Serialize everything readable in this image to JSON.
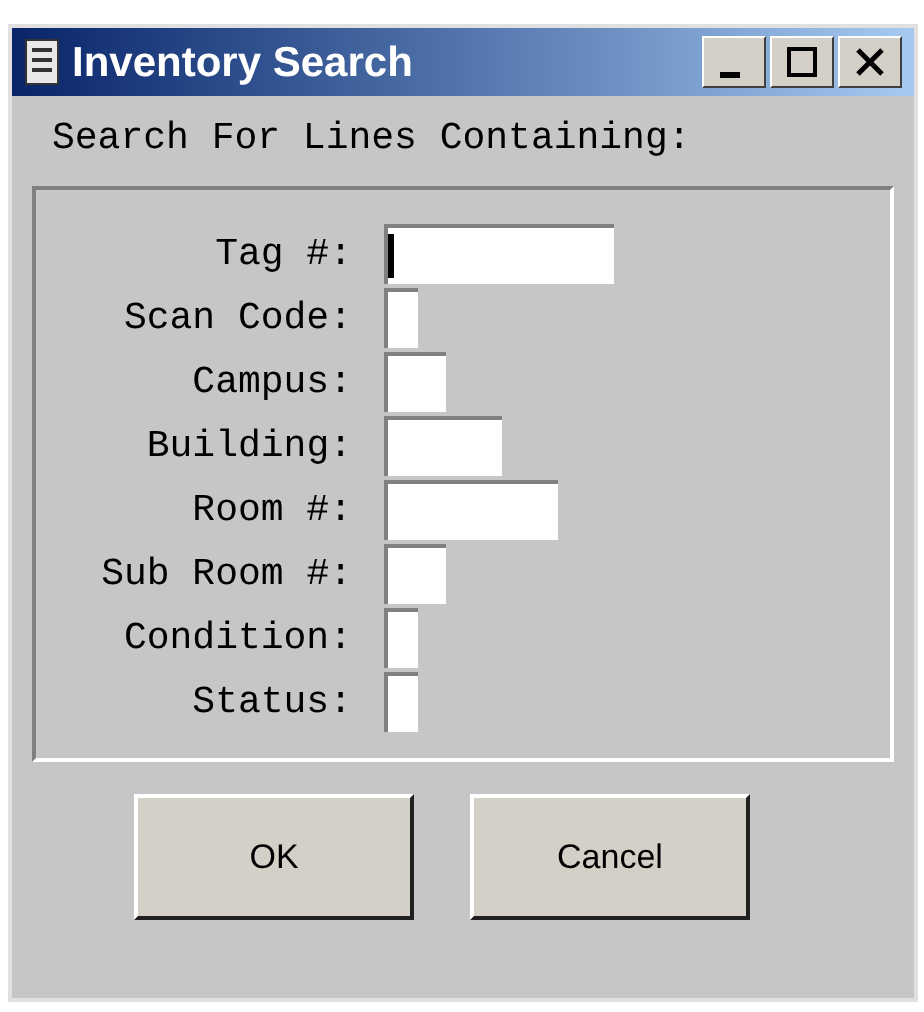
{
  "window": {
    "title": "Inventory Search"
  },
  "heading": "Search For Lines Containing:",
  "fields": [
    {
      "label": "Tag #:",
      "focused": true
    },
    {
      "label": "Scan Code:",
      "focused": false
    },
    {
      "label": "Campus:",
      "focused": false
    },
    {
      "label": "Building:",
      "focused": false
    },
    {
      "label": "Room #:",
      "focused": false
    },
    {
      "label": "Sub Room #:",
      "focused": false
    },
    {
      "label": "Condition:",
      "focused": false
    },
    {
      "label": "Status:",
      "focused": false
    }
  ],
  "buttons": [
    "OK",
    "Cancel"
  ]
}
